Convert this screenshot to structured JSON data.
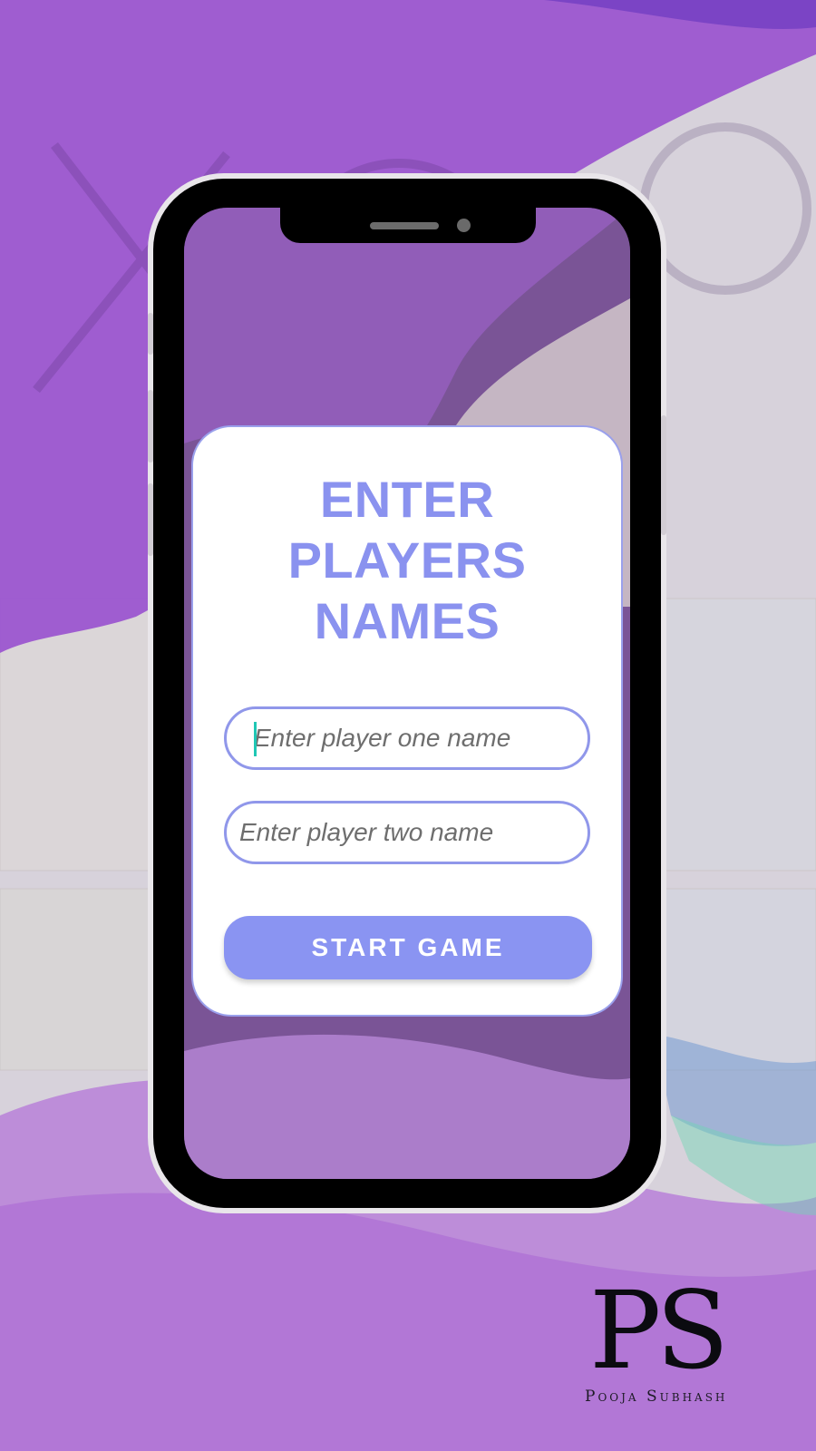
{
  "card": {
    "title_lines": [
      "ENTER",
      "PLAYERS",
      "NAMES"
    ],
    "player_one_placeholder": "Enter player one name",
    "player_two_placeholder": "Enter player two name",
    "start_label": "START GAME"
  },
  "branding": {
    "monogram": "PS",
    "name": "Pooja Subhash"
  },
  "colors": {
    "accent": "#8a92ef",
    "field_border": "#9097ea",
    "button": "#8a94f2",
    "caret": "#20c7b4",
    "purple": "#9a4fd0"
  }
}
